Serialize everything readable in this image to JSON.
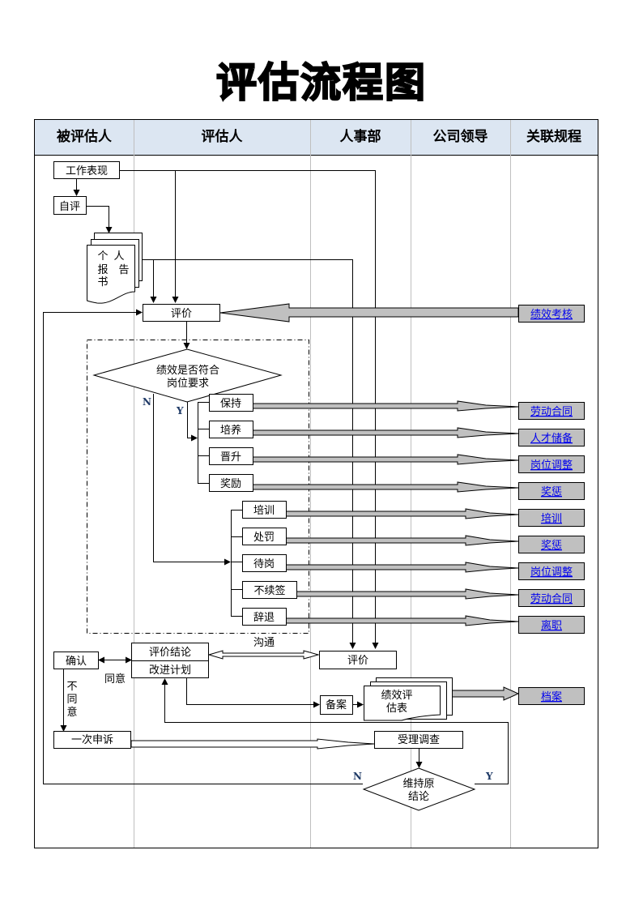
{
  "title": "评估流程图",
  "lanes": [
    "被评估人",
    "评估人",
    "人事部",
    "公司领导",
    "关联规程"
  ],
  "colors": {
    "header_bg": "#dce6f2",
    "link": "#0000ee",
    "ref_box": "#c0c0c0",
    "fat_arrow": "#c0c0c0",
    "lane_divider": "#bfbfbf"
  },
  "nodes": {
    "work_performance": "工作表现",
    "self_eval": "自评",
    "personal_report": [
      "个人",
      "报告",
      "书"
    ],
    "evaluate_assessor": "评价",
    "decision_meets": [
      "绩效是否符合",
      "岗位要求"
    ],
    "yes_label": "Y",
    "no_label": "N",
    "outcomes_yes": [
      "保持",
      "培养",
      "晋升",
      "奖励"
    ],
    "outcomes_no": [
      "培训",
      "处罚",
      "待岗",
      "不续签",
      "辞退"
    ],
    "confirm": "确认",
    "conclusion": "评价结论",
    "improve_plan": "改进计划",
    "agree": "同意",
    "disagree": [
      "不",
      "同",
      "意"
    ],
    "communicate": "沟通",
    "evaluate_hr": "评价",
    "file_record": "备案",
    "eval_form": [
      "绩效评",
      "估表"
    ],
    "appeal": "一次申诉",
    "investigate": "受理调查",
    "decision_maintain": [
      "维持原",
      "结论"
    ],
    "maintain_no": "N",
    "maintain_yes": "Y"
  },
  "related_procedures": {
    "performance_review": "绩效考核",
    "keep": "劳动合同",
    "cultivate": "人才储备",
    "promote": "岗位调整",
    "reward": "奖惩",
    "train": "培训",
    "punish": "奖惩",
    "standby": "岗位调整",
    "no_renew": "劳动合同",
    "dismiss": "离职",
    "archive": "档案"
  }
}
